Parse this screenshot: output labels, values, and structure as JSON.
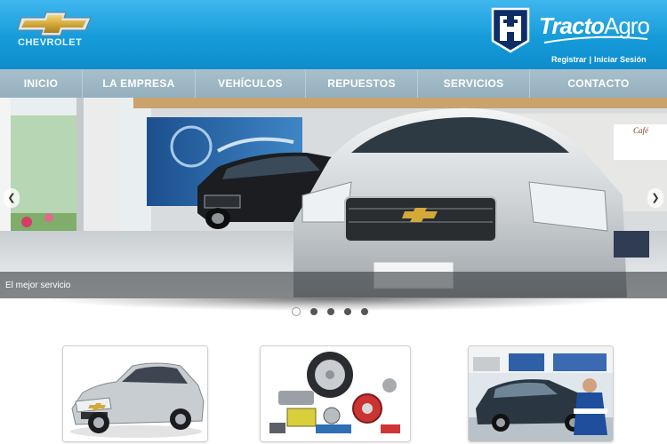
{
  "header": {
    "brand_left": "CHEVROLET",
    "brand_right_bold": "Tracto",
    "brand_right_light": "Agro",
    "auth": {
      "register": "Registrar",
      "separator": "|",
      "login": "Iniciar Sesión"
    }
  },
  "nav": {
    "items": [
      {
        "label": "INICIO"
      },
      {
        "label": "LA EMPRESA"
      },
      {
        "label": "VEHÍCULOS"
      },
      {
        "label": "REPUESTOS"
      },
      {
        "label": "SERVICIOS"
      },
      {
        "label": "CONTACTO"
      }
    ]
  },
  "slider": {
    "caption": "El mejor servicio",
    "prev_icon": "chevron-left-icon",
    "next_icon": "chevron-right-icon",
    "dots_count": 5,
    "active_dot": 1,
    "cafe_sign": "Café"
  },
  "cards": [
    {
      "name": "vehicles-card",
      "image": "silver-sedan"
    },
    {
      "name": "parts-card",
      "image": "auto-parts"
    },
    {
      "name": "service-card",
      "image": "workshop-service"
    }
  ],
  "colors": {
    "header_blue": "#169bd9",
    "nav_gray": "#a2bac7",
    "chevy_gold": "#d4a93a"
  }
}
